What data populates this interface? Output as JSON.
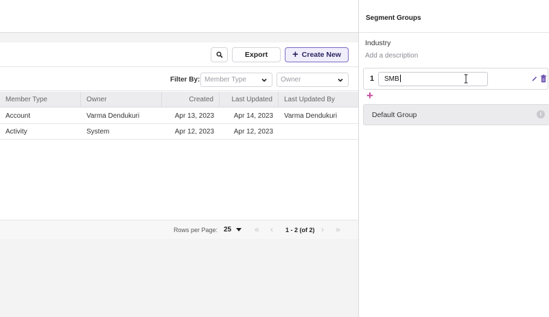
{
  "toolbar": {
    "search_icon": "search-icon",
    "export_label": "Export",
    "create_label": "Create New"
  },
  "filters": {
    "label": "Filter By:",
    "member_type_placeholder": "Member Type",
    "owner_placeholder": "Owner"
  },
  "table": {
    "columns": [
      "Member Type",
      "Owner",
      "Created",
      "Last Updated",
      "Last Updated By"
    ],
    "rows": [
      [
        "Account",
        "Varma Dendukuri",
        "Apr 13, 2023",
        "Apr 14, 2023",
        "Varma Dendukuri"
      ],
      [
        "Activity",
        "System",
        "Apr 12, 2023",
        "Apr 12, 2023",
        ""
      ]
    ]
  },
  "pagination": {
    "rows_per_page_label": "Rows per Page:",
    "rows_per_page_value": "25",
    "range_text": "1 - 2 (of 2)"
  },
  "panel": {
    "title": "Segment Groups",
    "segment_name": "Industry",
    "description_placeholder": "Add a description",
    "group_number": "1",
    "group_value": "SMB",
    "default_group_label": "Default Group"
  },
  "colors": {
    "accent": "#7b6bc4",
    "add_icon": "#c2489a",
    "trash": "#5b3fa8"
  }
}
